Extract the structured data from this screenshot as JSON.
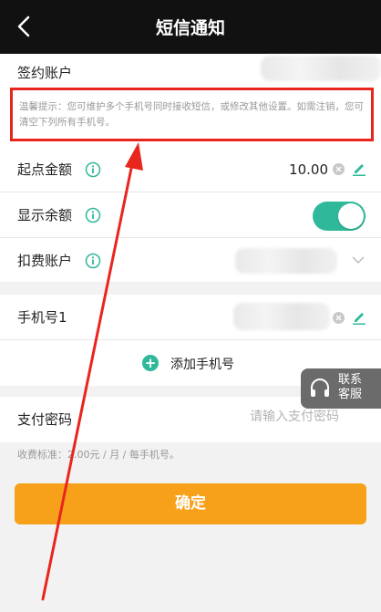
{
  "header": {
    "title": "短信通知",
    "back_icon": "chevron-left-icon"
  },
  "account": {
    "label": "签约账户"
  },
  "tip": {
    "text": "温馨提示：您可维护多个手机号同时接收短信，或修改其他设置。如需注销，您可清空下列所有手机号。"
  },
  "settings": {
    "start_amount": {
      "label": "起点金额",
      "value": "10.00"
    },
    "show_balance": {
      "label": "显示余额",
      "enabled": true
    },
    "debit_account": {
      "label": "扣费账户"
    }
  },
  "phones": {
    "items": [
      {
        "label": "手机号1"
      }
    ],
    "add_label": "添加手机号"
  },
  "service": {
    "line1": "联系",
    "line2": "客服"
  },
  "payment": {
    "label": "支付密码",
    "placeholder": "请输入支付密码"
  },
  "fee": {
    "text": "收费标准：2.00元 / 月 / 每手机号。"
  },
  "confirm": {
    "label": "确定"
  },
  "colors": {
    "accent": "#2fb99a",
    "button": "#f7a11b",
    "highlight": "#e8261d",
    "header": "#111111"
  }
}
